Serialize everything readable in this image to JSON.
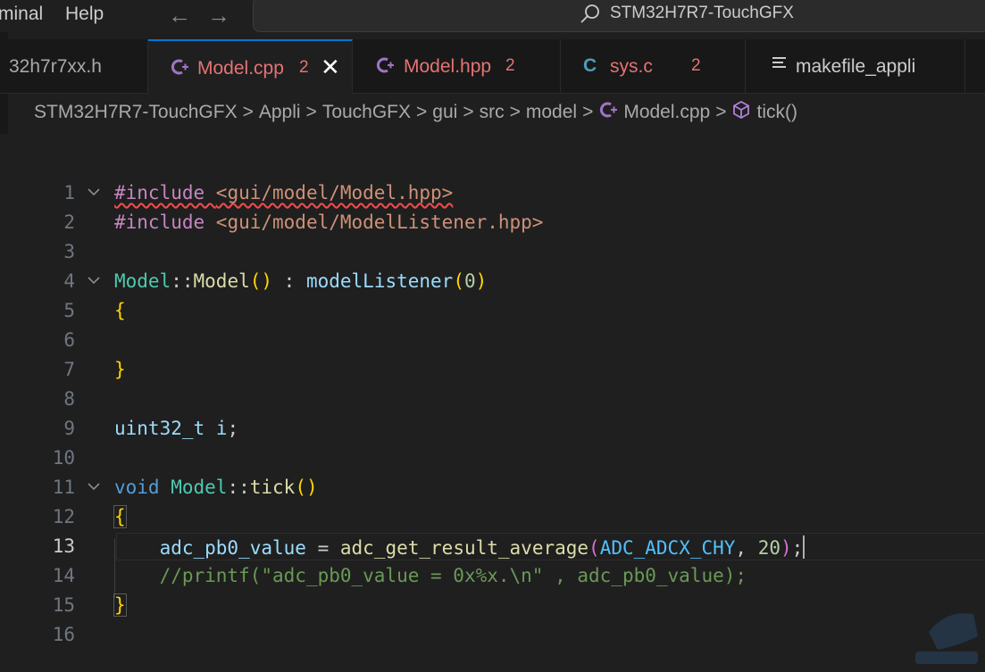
{
  "menubar": {
    "items": [
      "minal",
      "Help"
    ],
    "back_arrow": "←",
    "forward_arrow": "→",
    "search_text": "STM32H7R7-TouchGFX"
  },
  "tabs": [
    {
      "label": "32h7r7xx.h",
      "icon": "",
      "badge": "",
      "active": false
    },
    {
      "label": "Model.cpp",
      "icon": "C++",
      "badge": "2",
      "active": true,
      "close": "✕"
    },
    {
      "label": "Model.hpp",
      "icon": "C++",
      "badge": "2",
      "active": false
    },
    {
      "label": "sys.c",
      "icon": "C",
      "badge": "2",
      "active": false
    },
    {
      "label": "makefile_appli",
      "icon": "lines",
      "badge": "",
      "active": false
    }
  ],
  "breadcrumb": [
    "STM32H7R7-TouchGFX",
    "Appli",
    "TouchGFX",
    "gui",
    "src",
    "model",
    "Model.cpp",
    "tick()"
  ],
  "editor": {
    "line_numbers": [
      "1",
      "2",
      "3",
      "4",
      "5",
      "6",
      "7",
      "8",
      "9",
      "10",
      "11",
      "12",
      "13",
      "14",
      "15",
      "16"
    ],
    "current_line": 13,
    "lines": {
      "l1": [
        "#include ",
        "<gui/model/Model.hpp>"
      ],
      "l2": [
        "#include ",
        "<gui/model/ModelListener.hpp>"
      ],
      "l4": [
        "Model",
        "::",
        "Model",
        "()",
        " : ",
        "modelListener",
        "(",
        "0",
        ")"
      ],
      "l5": [
        "{"
      ],
      "l7": [
        "}"
      ],
      "l9": [
        "uint32_t",
        " ",
        "i",
        ";"
      ],
      "l11": [
        "void",
        " ",
        "Model",
        "::",
        "tick",
        "()"
      ],
      "l12": [
        "{"
      ],
      "l13": [
        "    ",
        "adc_pb0_value",
        " = ",
        "adc_get_result_average",
        "(",
        "ADC_ADCX_CHY",
        ", ",
        "20",
        ")",
        ";"
      ],
      "l14": [
        "    ",
        "//printf(\"adc_pb0_value = 0x%x.\\n\" , adc_pb0_value);"
      ],
      "l15": [
        "}"
      ]
    }
  },
  "colors": {
    "background": "#1f1f1f",
    "accent": "#0078d4",
    "badge": "#e57373",
    "keyword": "#569cd6",
    "type": "#4ec9b0",
    "function": "#dcdcaa",
    "variable": "#9cdcfe",
    "string": "#ce9178",
    "comment": "#6a9955"
  }
}
